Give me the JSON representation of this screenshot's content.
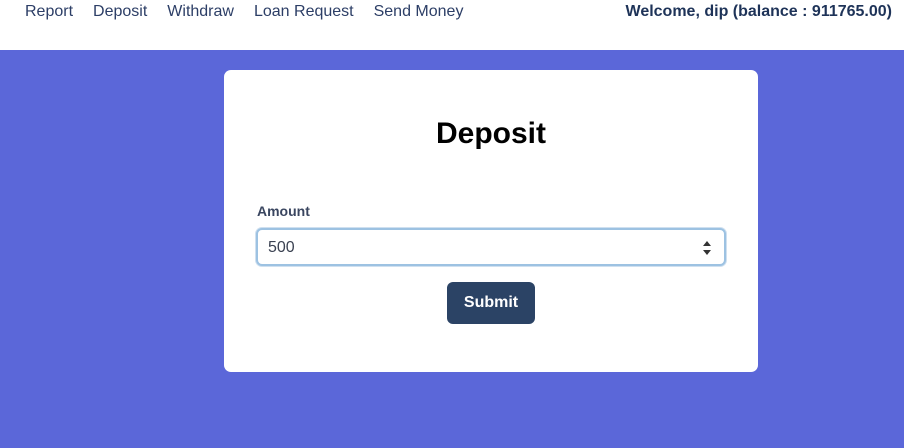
{
  "nav": {
    "items": [
      {
        "label": "Report"
      },
      {
        "label": "Deposit"
      },
      {
        "label": "Withdraw"
      },
      {
        "label": "Loan Request"
      },
      {
        "label": "Send Money"
      }
    ],
    "welcome": "Welcome, dip (balance : 911765.00)"
  },
  "form": {
    "title": "Deposit",
    "amount_label": "Amount",
    "amount_value": "500",
    "spinner_icon": "spinner-arrows-icon",
    "submit_label": "Submit"
  },
  "colors": {
    "background": "#5b67d9",
    "button": "#2b4365",
    "nav_text": "#2c3e66"
  }
}
